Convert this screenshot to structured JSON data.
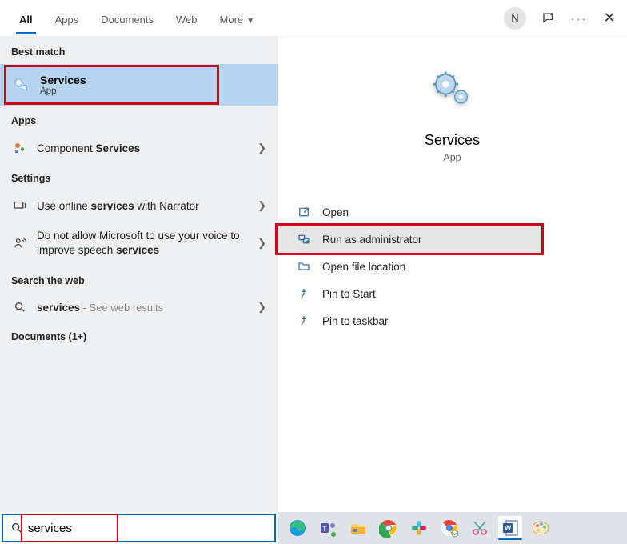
{
  "tabs": {
    "all": "All",
    "apps": "Apps",
    "documents": "Documents",
    "web": "Web",
    "more": "More"
  },
  "avatar_initial": "N",
  "sections": {
    "best_match": "Best match",
    "apps": "Apps",
    "settings": "Settings",
    "search_web": "Search the web",
    "documents": "Documents (1+)"
  },
  "best": {
    "title": "Services",
    "sub": "App"
  },
  "apps_row": {
    "prefix": "Component ",
    "bold": "Services"
  },
  "settings_rows": {
    "row1": {
      "prefix": "Use online ",
      "bold": "services",
      "suffix": " with Narrator"
    },
    "row2": {
      "prefix": "Do not allow Microsoft to use your voice to improve speech ",
      "bold": "services"
    }
  },
  "web_row": {
    "bold": "services",
    "suffix": " - See web results"
  },
  "preview": {
    "title": "Services",
    "sub": "App"
  },
  "actions": {
    "open": "Open",
    "run_admin": "Run as administrator",
    "open_loc": "Open file location",
    "pin_start": "Pin to Start",
    "pin_taskbar": "Pin to taskbar"
  },
  "search_value": "services"
}
